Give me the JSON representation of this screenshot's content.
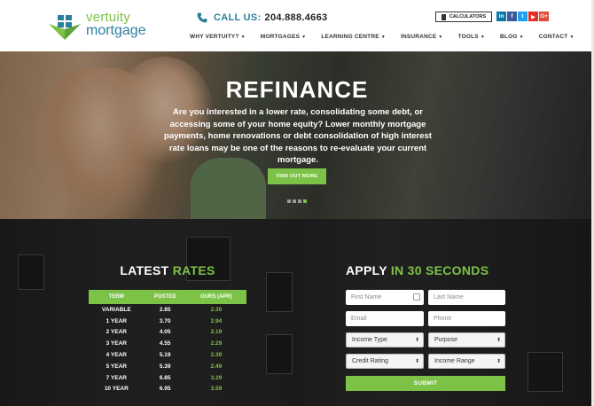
{
  "header": {
    "logo": {
      "line1": "vertuity",
      "line2": "mortgage"
    },
    "call": {
      "label": "CALL US:",
      "number": "204.888.4663"
    },
    "calculators_label": "CALCULATORS",
    "social": [
      {
        "name": "linkedin-icon",
        "glyph": "in",
        "color": "#0e76a8"
      },
      {
        "name": "facebook-icon",
        "glyph": "f",
        "color": "#3b5998"
      },
      {
        "name": "twitter-icon",
        "glyph": "t",
        "color": "#1da1f2"
      },
      {
        "name": "youtube-icon",
        "glyph": "▶",
        "color": "#e52d27"
      },
      {
        "name": "googleplus-icon",
        "glyph": "G+",
        "color": "#dd4b39"
      }
    ],
    "nav": [
      {
        "label": "WHY VERTUITY?"
      },
      {
        "label": "MORTGAGES"
      },
      {
        "label": "LEARNING CENTRE"
      },
      {
        "label": "INSURANCE"
      },
      {
        "label": "TOOLS"
      },
      {
        "label": "BLOG"
      },
      {
        "label": "CONTACT"
      }
    ]
  },
  "hero": {
    "title": "REFINANCE",
    "text": "Are you interested in a lower rate, consolidating some debt, or accessing some of your home equity? Lower monthly mortgage payments, home renovations or debt consolidation of high interest rate loans may be one of the reasons to re-evaluate your current mortgage.",
    "button": "FIND OUT MORE",
    "slides": 4,
    "active_slide": 4
  },
  "rates": {
    "title_white": "LATEST",
    "title_green": "RATES",
    "columns": [
      "TERM",
      "POSTED",
      "OURS (APR)"
    ],
    "rows": [
      [
        "VARIABLE",
        "2.85",
        "2.30"
      ],
      [
        "1 YEAR",
        "3.70",
        "2.94"
      ],
      [
        "2 YEAR",
        "4.05",
        "2.19"
      ],
      [
        "3 YEAR",
        "4.55",
        "2.29"
      ],
      [
        "4 YEAR",
        "5.19",
        "2.39"
      ],
      [
        "5 YEAR",
        "5.39",
        "2.49"
      ],
      [
        "7 YEAR",
        "6.85",
        "3.29"
      ],
      [
        "10 YEAR",
        "6.95",
        "3.59"
      ]
    ]
  },
  "apply": {
    "title_white": "APPLY",
    "title_green": "IN 30 SECONDS",
    "first_name": "First Name",
    "last_name": "Last Name",
    "email": "Email",
    "phone": "Phone",
    "income_type": "Income Type",
    "purpose": "Purpose",
    "credit_rating": "Credit Rating",
    "income_range": "Income Range",
    "submit": "SUBMIT"
  },
  "colors": {
    "brand_green": "#7cc246",
    "brand_blue": "#2a7e9d"
  }
}
